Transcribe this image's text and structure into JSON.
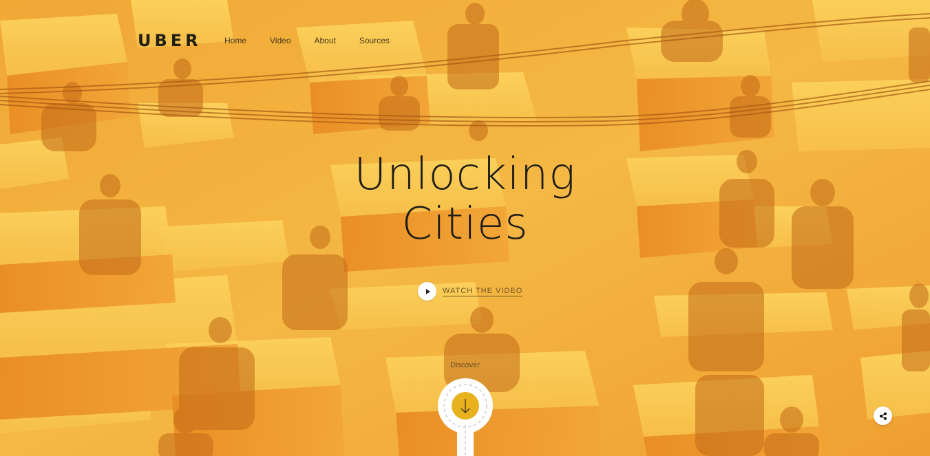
{
  "brand": {
    "logo_text": "UBER"
  },
  "nav": {
    "items": [
      {
        "label": "Home"
      },
      {
        "label": "Video"
      },
      {
        "label": "About"
      },
      {
        "label": "Sources"
      }
    ]
  },
  "hero": {
    "title_line1": "Unlocking",
    "title_line2": "Cities",
    "watch_label": "WATCH THE VIDEO",
    "play_icon": "play-icon",
    "discover_label": "Discover",
    "discover_icon": "arrow-down-icon",
    "share_icon": "share-icon",
    "background_description_icon": "hero-photo-overlay"
  },
  "colors": {
    "overlay": "#f2ae3c",
    "overlay_dark": "#e0891f",
    "text_dark": "#1f1d17",
    "white": "#ffffff"
  }
}
